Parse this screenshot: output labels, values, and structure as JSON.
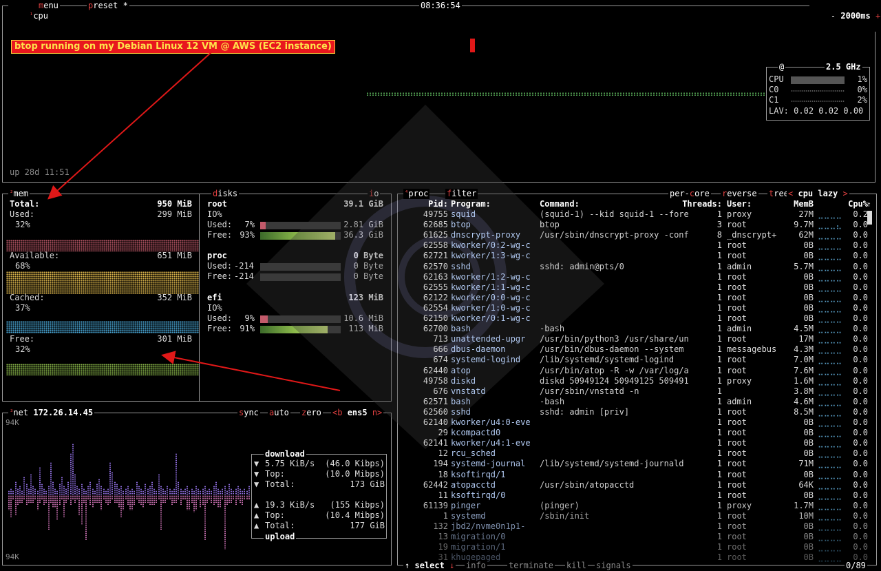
{
  "cpu": {
    "title": "cpu",
    "num": "¹",
    "menu": "menu",
    "preset": "preset *",
    "clock": "08:36:54",
    "minus": "-",
    "interval": "2000ms",
    "plus": "+",
    "uptime": "up 28d 11:51",
    "annotation": "btop running on my Debian Linux 12 VM @ AWS (EC2 instance)",
    "freq_at": "@",
    "freq": "2.5 GHz",
    "cores": [
      {
        "label": "CPU",
        "pct": "1%",
        "level": 1
      },
      {
        "label": "C0",
        "pct": "0%",
        "level": 0
      },
      {
        "label": "C1",
        "pct": "2%",
        "level": 2
      }
    ],
    "lav_label": "LAV:",
    "lav": "0.02 0.02 0.00"
  },
  "mem": {
    "title": "mem",
    "num": "²",
    "total_label": "Total:",
    "total": "950 MiB",
    "used_label": "Used:",
    "used": "299 MiB",
    "used_pct": "32%",
    "avail_label": "Available:",
    "avail": "651 MiB",
    "avail_pct": "68%",
    "cached_label": "Cached:",
    "cached": "352 MiB",
    "cached_pct": "37%",
    "free_label": "Free:",
    "free": "301 MiB",
    "free_pct": "32%",
    "colors": {
      "used": "#c25a6a",
      "avail": "#d8b24a",
      "cached": "#4aa8d8",
      "free": "#8ab84a"
    }
  },
  "disks": {
    "title": "disks",
    "io": "io",
    "root": {
      "name": "root",
      "size": "39.1 GiB",
      "io": "IO%",
      "used_label": "Used:",
      "used_pct": "7%",
      "used": "2.81 GiB",
      "used_level": 7,
      "free_label": "Free:",
      "free_pct": "93%",
      "free": "36.3 GiB",
      "free_level": 93
    },
    "proc": {
      "name": "proc",
      "size": "0 Byte",
      "used_label": "Used:",
      "used_pct": "-214",
      "used": "0 Byte",
      "free_label": "Free:",
      "free_pct": "-214",
      "free": "0 Byte"
    },
    "efi": {
      "name": "efi",
      "size": "123 MiB",
      "io": "IO%",
      "used_label": "Used:",
      "used_pct": "9%",
      "used": "10.6 MiB",
      "used_level": 9,
      "free_label": "Free:",
      "free_pct": "91%",
      "free": "113 MiB",
      "free_level": 91
    }
  },
  "net": {
    "title": "net",
    "num": "³",
    "ip": "172.26.14.45",
    "sync": "sync",
    "auto": "auto",
    "zero": "zero",
    "prev": "<b",
    "iface": "ens5",
    "next": "n>",
    "scale_top": "94K",
    "scale_bottom": "94K",
    "download_label": "download",
    "dl_rate": "5.75 KiB/s",
    "dl_rate_b": "(46.0 Kibps)",
    "dl_top_label": "Top:",
    "dl_top": "(10.0 Mibps)",
    "dl_total_label": "Total:",
    "dl_total": "173 GiB",
    "ul_rate": "19.3 KiB/s",
    "ul_rate_b": "(155 Kibps)",
    "ul_top_label": "Top:",
    "ul_top": "(10.4 Mibps)",
    "ul_total_label": "Total:",
    "ul_total": "177 GiB",
    "upload_label": "upload"
  },
  "proc": {
    "title": "proc",
    "num": "⁴",
    "filter": "filter",
    "per_core": "per-core",
    "reverse": "reverse",
    "tree": "tree",
    "lt": "<",
    "sort": "cpu lazy",
    "gt": ">",
    "headers": {
      "pid": "Pid:",
      "program": "Program:",
      "command": "Command:",
      "threads": "Threads:",
      "user": "User:",
      "mem": "MemB",
      "cpu": "Cpu%"
    },
    "rows": [
      {
        "pid": "49755",
        "program": "squid",
        "command": "(squid-1) --kid squid-1 --fore",
        "threads": "1",
        "user": "proxy",
        "mem": "27M",
        "graph": "⣀⣀⣀⣀⣀⣀",
        "cpu": "0.2"
      },
      {
        "pid": "62685",
        "program": "btop",
        "command": "btop",
        "threads": "3",
        "user": "root",
        "mem": "9.7M",
        "graph": "⣀⣀⣀⣄⣀⣤",
        "cpu": "0.0"
      },
      {
        "pid": "61625",
        "program": "dnscrypt-proxy",
        "command": "/usr/sbin/dnscrypt-proxy -conf",
        "threads": "8",
        "user": "_dnscrypt+",
        "mem": "62M",
        "graph": "⣀⣀⣀⣀⣀⣤",
        "cpu": "0.0"
      },
      {
        "pid": "62558",
        "program": "kworker/0:2-wg-c",
        "command": "",
        "threads": "1",
        "user": "root",
        "mem": "0B",
        "graph": "⣀⣀⣀⣀⣀⣀",
        "cpu": "0.0"
      },
      {
        "pid": "62721",
        "program": "kworker/1:3-wg-c",
        "command": "",
        "threads": "1",
        "user": "root",
        "mem": "0B",
        "graph": "⣀⣀⣀⣀⣀⣀",
        "cpu": "0.0"
      },
      {
        "pid": "62570",
        "program": "sshd",
        "command": "sshd: admin@pts/0",
        "threads": "1",
        "user": "admin",
        "mem": "5.7M",
        "graph": "⣀⣀⣀⣀⣀⣀",
        "cpu": "0.0"
      },
      {
        "pid": "62163",
        "program": "kworker/1:2-wg-c",
        "command": "",
        "threads": "1",
        "user": "root",
        "mem": "0B",
        "graph": "⣀⣀⣀⣀⣀⣀",
        "cpu": "0.0"
      },
      {
        "pid": "62555",
        "program": "kworker/1:1-wg-c",
        "command": "",
        "threads": "1",
        "user": "root",
        "mem": "0B",
        "graph": "⣀⣀⣀⣀⣀⣀",
        "cpu": "0.0"
      },
      {
        "pid": "62122",
        "program": "kworker/0:0-wg-c",
        "command": "",
        "threads": "1",
        "user": "root",
        "mem": "0B",
        "graph": "⣀⣀⣀⣀⣀⣀",
        "cpu": "0.0"
      },
      {
        "pid": "62554",
        "program": "kworker/1:0-wg-c",
        "command": "",
        "threads": "1",
        "user": "root",
        "mem": "0B",
        "graph": "⣀⣀⣀⣀⣀⣀",
        "cpu": "0.0"
      },
      {
        "pid": "62150",
        "program": "kworker/0:1-wg-c",
        "command": "",
        "threads": "1",
        "user": "root",
        "mem": "0B",
        "graph": "⣀⣀⣀⣀⣀⣀",
        "cpu": "0.0"
      },
      {
        "pid": "62700",
        "program": "bash",
        "command": "-bash",
        "threads": "1",
        "user": "admin",
        "mem": "4.5M",
        "graph": "⣀⣀⣀⣀⣀⣀",
        "cpu": "0.0"
      },
      {
        "pid": "713",
        "program": "unattended-upgr",
        "command": "/usr/bin/python3 /usr/share/un",
        "threads": "1",
        "user": "root",
        "mem": "17M",
        "graph": "⣀⣀⣀⣀⣀⣀",
        "cpu": "0.0"
      },
      {
        "pid": "666",
        "program": "dbus-daemon",
        "command": "/usr/bin/dbus-daemon --system",
        "threads": "1",
        "user": "messagebus",
        "mem": "4.3M",
        "graph": "⣀⣀⣀⣀⣀⣀",
        "cpu": "0.0"
      },
      {
        "pid": "674",
        "program": "systemd-logind",
        "command": "/lib/systemd/systemd-logind",
        "threads": "1",
        "user": "root",
        "mem": "7.0M",
        "graph": "⣀⣀⣀⣀⣀⣀",
        "cpu": "0.0"
      },
      {
        "pid": "62440",
        "program": "atop",
        "command": "/usr/bin/atop -R -w /var/log/a",
        "threads": "1",
        "user": "root",
        "mem": "7.6M",
        "graph": "⣀⣀⣀⣀⣀⣀",
        "cpu": "0.0"
      },
      {
        "pid": "49758",
        "program": "diskd",
        "command": "diskd 50949124 50949125 509491",
        "threads": "1",
        "user": "proxy",
        "mem": "1.6M",
        "graph": "⣀⣀⣀⣀⣀⣀",
        "cpu": "0.0"
      },
      {
        "pid": "676",
        "program": "vnstatd",
        "command": "/usr/sbin/vnstatd -n",
        "threads": "1",
        "user": "",
        "mem": "3.8M",
        "graph": "⣀⣀⣀⣀⣀⣀",
        "cpu": "0.0"
      },
      {
        "pid": "62571",
        "program": "bash",
        "command": "-bash",
        "threads": "1",
        "user": "admin",
        "mem": "4.6M",
        "graph": "⣀⣀⣀⣀⣀⣀",
        "cpu": "0.0"
      },
      {
        "pid": "62560",
        "program": "sshd",
        "command": "sshd: admin [priv]",
        "threads": "1",
        "user": "root",
        "mem": "8.5M",
        "graph": "⣀⣀⣀⣀⣀⣀",
        "cpu": "0.0"
      },
      {
        "pid": "62140",
        "program": "kworker/u4:0-eve",
        "command": "",
        "threads": "1",
        "user": "root",
        "mem": "0B",
        "graph": "⣀⣀⣀⣀⣀⣀",
        "cpu": "0.0"
      },
      {
        "pid": "29",
        "program": "kcompactd0",
        "command": "",
        "threads": "1",
        "user": "root",
        "mem": "0B",
        "graph": "⣀⣀⣀⣀⣀⣀",
        "cpu": "0.0"
      },
      {
        "pid": "62141",
        "program": "kworker/u4:1-eve",
        "command": "",
        "threads": "1",
        "user": "root",
        "mem": "0B",
        "graph": "⣀⣀⣀⣀⣀⣀",
        "cpu": "0.0"
      },
      {
        "pid": "12",
        "program": "rcu_sched",
        "command": "",
        "threads": "1",
        "user": "root",
        "mem": "0B",
        "graph": "⣀⣀⣀⣀⣀⣀",
        "cpu": "0.0"
      },
      {
        "pid": "194",
        "program": "systemd-journal",
        "command": "/lib/systemd/systemd-journald",
        "threads": "1",
        "user": "root",
        "mem": "71M",
        "graph": "⣀⣀⣀⣀⣀⣀",
        "cpu": "0.0"
      },
      {
        "pid": "18",
        "program": "ksoftirqd/1",
        "command": "",
        "threads": "1",
        "user": "root",
        "mem": "0B",
        "graph": "⣀⣀⣀⣀⣀⣀",
        "cpu": "0.0"
      },
      {
        "pid": "62442",
        "program": "atopacctd",
        "command": "/usr/sbin/atopacctd",
        "threads": "1",
        "user": "root",
        "mem": "64K",
        "graph": "⣀⣀⣀⣀⣀⣀",
        "cpu": "0.0"
      },
      {
        "pid": "11",
        "program": "ksoftirqd/0",
        "command": "",
        "threads": "1",
        "user": "root",
        "mem": "0B",
        "graph": "⣀⣀⣀⣀⣀⣀",
        "cpu": "0.0"
      },
      {
        "pid": "61139",
        "program": "pinger",
        "command": "(pinger)",
        "threads": "1",
        "user": "proxy",
        "mem": "1.7M",
        "graph": "⣀⣀⣀⣀⣀⣀",
        "cpu": "0.0"
      },
      {
        "pid": "1",
        "program": "systemd",
        "command": "/sbin/init",
        "threads": "1",
        "user": "root",
        "mem": "10M",
        "graph": "⣀⣀⣀⣀⣀⣀",
        "cpu": "0.0"
      },
      {
        "pid": "132",
        "program": "jbd2/nvme0n1p1-",
        "command": "",
        "threads": "1",
        "user": "root",
        "mem": "0B",
        "graph": "⣀⣀⣀⣀⣀⣀",
        "cpu": "0.0"
      },
      {
        "pid": "13",
        "program": "migration/0",
        "command": "",
        "threads": "1",
        "user": "root",
        "mem": "0B",
        "graph": "⣀⣀⣀⣀⣀⣀",
        "cpu": "0.0"
      },
      {
        "pid": "19",
        "program": "migration/1",
        "command": "",
        "threads": "1",
        "user": "root",
        "mem": "0B",
        "graph": "⣀⣀⣀⣀⣀⣀",
        "cpu": "0.0"
      },
      {
        "pid": "31",
        "program": "khugepaged",
        "command": "",
        "threads": "1",
        "user": "root",
        "mem": "0B",
        "graph": "⣀⣀⣀⣀⣀⣀",
        "cpu": "0.0"
      }
    ],
    "footer": {
      "up": "↑",
      "select": "select",
      "down": "↓",
      "info": "info",
      "terminate": "terminate",
      "kill": "kill",
      "signals": "signals",
      "count": "0/89"
    }
  },
  "colors": {
    "accent": "#e04040",
    "border": "#9a9a9a",
    "graph_green": "#4a8a4a",
    "annotation_bg": "#e8161e",
    "annotation_fg": "#ffe14a"
  }
}
